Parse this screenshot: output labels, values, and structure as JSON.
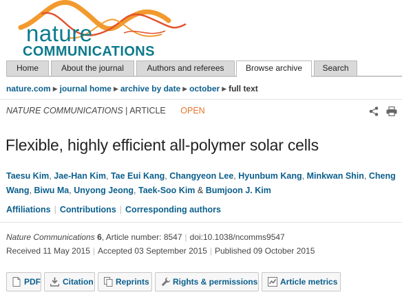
{
  "logo": {
    "word1": "nature",
    "word2": "COMMUNICATIONS"
  },
  "nav": {
    "tabs": [
      {
        "label": "Home"
      },
      {
        "label": "About the journal"
      },
      {
        "label": "Authors and referees"
      },
      {
        "label": "Browse archive"
      },
      {
        "label": "Search"
      }
    ],
    "active_tab": "Browse archive"
  },
  "breadcrumb": [
    "nature.com",
    "journal home",
    "archive by date",
    "october",
    "full text"
  ],
  "article": {
    "journal": "NATURE COMMUNICATIONS",
    "divider": "|",
    "type": "ARTICLE",
    "access": "OPEN",
    "title": "Flexible, highly efficient all-polymer solar cells",
    "authors": [
      "Taesu Kim",
      "Jae-Han Kim",
      "Tae Eui Kang",
      "Changyeon Lee",
      "Hyunbum Kang",
      "Minkwan Shin",
      "Cheng Wang",
      "Biwu Ma",
      "Unyong Jeong",
      "Taek-Soo Kim",
      "Bumjoon J. Kim"
    ],
    "author_separator": ",",
    "author_conjunction": "&",
    "info_links": [
      "Affiliations",
      "Contributions",
      "Corresponding authors"
    ],
    "citation": {
      "journal": "Nature Communications",
      "volume": "6",
      "article_number_label": "Article number:",
      "article_number": "8547",
      "doi": "doi:10.1038/ncomms9547"
    },
    "dates": {
      "received_label": "Received",
      "received": "11 May 2015",
      "accepted_label": "Accepted",
      "accepted": "03 September 2015",
      "published_label": "Published",
      "published": "09 October 2015"
    }
  },
  "actions": [
    {
      "label": "PDF",
      "icon": "pdf-icon"
    },
    {
      "label": "Citation",
      "icon": "download-icon"
    },
    {
      "label": "Reprints",
      "icon": "reprints-icon"
    },
    {
      "label": "Rights & permissions",
      "icon": "wrench-icon"
    },
    {
      "label": "Article metrics",
      "icon": "metrics-icon"
    }
  ],
  "colors": {
    "brand": "#0b7a8c",
    "link": "#0b5f8c",
    "open_access": "#e5742b",
    "swoosh_orange": "#f29a2e",
    "swoosh_red": "#e2532d",
    "tab_bg": "#d9d9d9"
  }
}
